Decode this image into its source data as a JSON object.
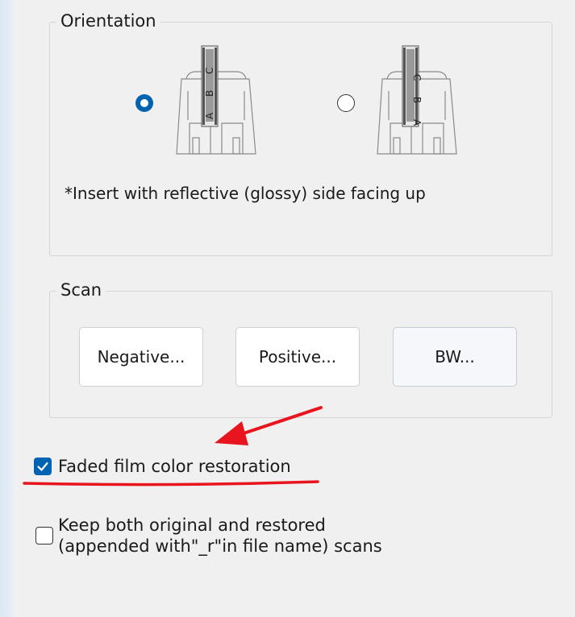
{
  "orientation": {
    "legend": "Orientation",
    "options": [
      {
        "id": "option-1",
        "selected": true,
        "film_letters": [
          "A",
          "B",
          "C"
        ]
      },
      {
        "id": "option-2",
        "selected": false,
        "film_letters": [
          "C",
          "B",
          "A"
        ]
      }
    ],
    "note": "*Insert with reflective (glossy) side facing up"
  },
  "scan": {
    "legend": "Scan",
    "buttons": {
      "negative": "Negative...",
      "positive": "Positive...",
      "bw": "BW..."
    }
  },
  "options": {
    "faded_restoration": {
      "label": "Faded film color restoration",
      "checked": true
    },
    "keep_both": {
      "line1": "Keep both original and restored",
      "line2": "(appended with\"_r\"in file name) scans",
      "checked": false
    }
  },
  "colors": {
    "accent": "#0063b1",
    "annotation": "#e8141e",
    "background": "#f0f0f0"
  }
}
